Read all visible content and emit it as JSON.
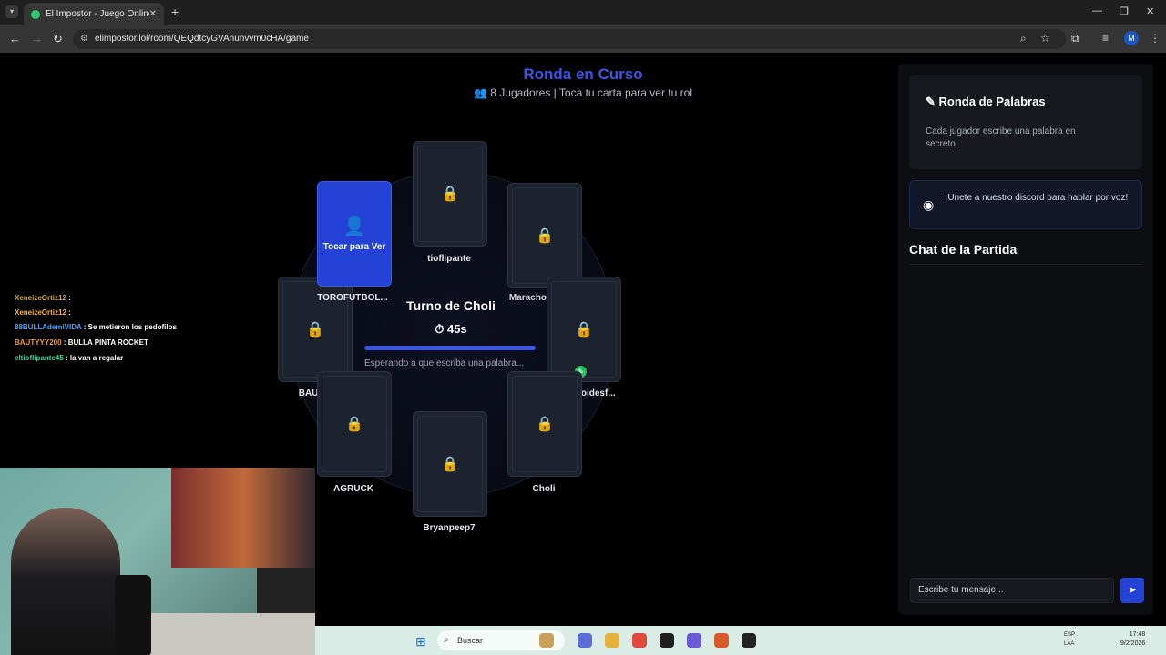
{
  "browser": {
    "tab_title": "El Impostor - Juego Online Gra",
    "url": "elimpostor.lol/room/QEQdtcyGVAnunvvm0cHA/game"
  },
  "game": {
    "heading": "Ronda en Curso",
    "subheading": "8 Jugadores | Toca tu carta para ver tu rol",
    "my_card_label": "Tocar para Ver",
    "turn_text": "Turno de Choli",
    "timer_text": "45s",
    "timer_progress": 1.0,
    "waiting_text": "Esperando a que escriba una palabra...",
    "players": [
      "tioflipante",
      "TOROFUTBOL...",
      "MarachoFraca...",
      "BAUTY",
      "Hemorroidesf...",
      "AGRUCK",
      "Choli",
      "Bryanpeep7"
    ]
  },
  "sidebar": {
    "round_title": "Ronda de Palabras",
    "round_desc": "Cada jugador escribe una palabra en secreto.",
    "discord_text": "¡Unete a nuestro discord para hablar por voz!",
    "chat_title": "Chat de la Partida",
    "chat_placeholder": "Escribe tu mensaje..."
  },
  "stream_chat": [
    {
      "user": "XeneizeOrtiz12",
      "msg": "",
      "color": "#c9a64a"
    },
    {
      "user": "XeneizeOrtiz12",
      "msg": "",
      "color": "#f0b44a"
    },
    {
      "user": "88BULLAdemiVIDA",
      "msg": "Se metieron los pedofilos",
      "color": "#4aa3ff"
    },
    {
      "user": "BAUTYYY200",
      "msg": "BULLA PINTA ROCKET",
      "color": "#f39c2a"
    },
    {
      "user": "eltioflipante45",
      "msg": "la van a regalar",
      "color": "#43d39a"
    }
  ],
  "taskbar": {
    "search_label": "Buscar",
    "lang": "ESP\nLAA",
    "time": "17:48",
    "date": "9/2/2026"
  }
}
